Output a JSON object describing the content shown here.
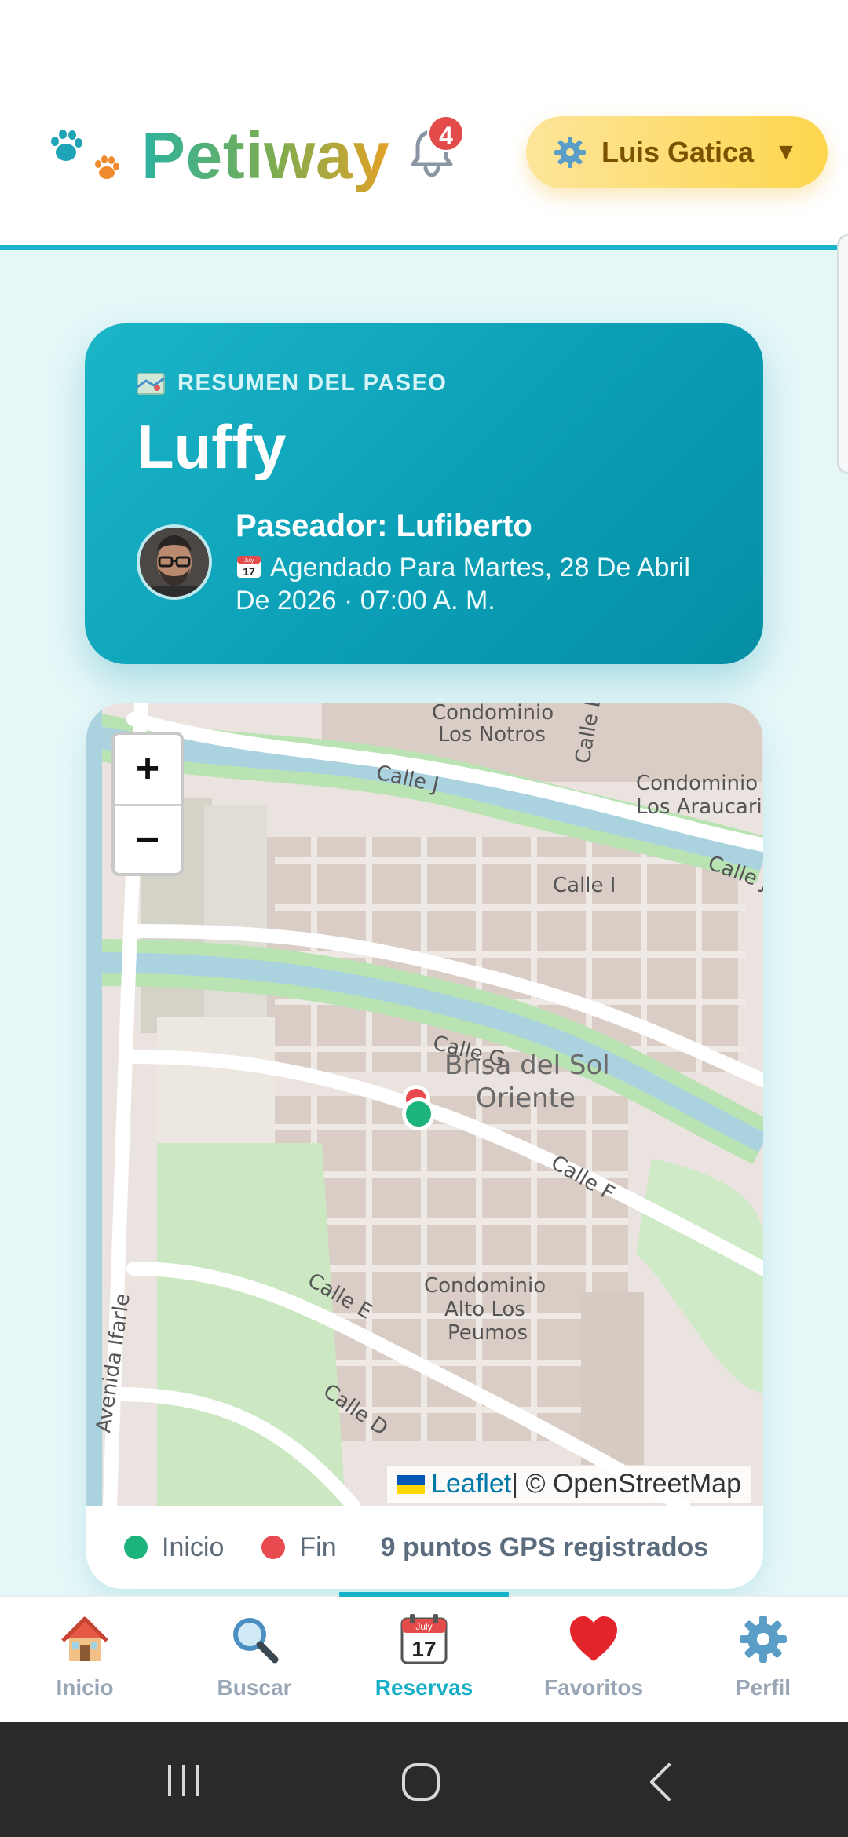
{
  "header": {
    "app_name": "Petiway",
    "notifications_count": "4",
    "user_name": "Luis Gatica",
    "user_caret": "▼"
  },
  "summary": {
    "label": "RESUMEN DEL PASEO",
    "pet_name": "Luffy",
    "walker": "Paseador: Lufiberto",
    "schedule": "Agendado Para Martes, 28 De Abril De 2026 · 07:00 A. M."
  },
  "map": {
    "zoom_in": "+",
    "zoom_out": "−",
    "labels": {
      "condominio_notros": [
        "Condominio",
        "Los Notros"
      ],
      "condominio_araucarias": [
        "Condominio",
        "Los Araucaria"
      ],
      "calle_l": "Calle L",
      "calle_j": "Calle J",
      "calle_j2": "Calle J",
      "calle_i": "Calle I",
      "calle_g": "Calle G",
      "calle_f": "Calle F",
      "calle_e": "Calle E",
      "calle_d": "Calle D",
      "avenida": "Avenida Ifarle",
      "brisa": [
        "Brisa del Sol",
        "Oriente"
      ],
      "condominio_alto": [
        "Condominio",
        "Alto Los",
        "Peumos"
      ]
    },
    "attribution_leaflet": "Leaflet",
    "attribution_rest": " | © OpenStreetMap"
  },
  "legend": {
    "start": "Inicio",
    "end": "Fin",
    "gps": "9 puntos GPS registrados",
    "start_color": "#1db37c",
    "end_color": "#e84a4f"
  },
  "nav": {
    "items": [
      {
        "label": "Inicio",
        "icon": "house-icon"
      },
      {
        "label": "Buscar",
        "icon": "magnifier-icon"
      },
      {
        "label": "Reservas",
        "icon": "calendar-icon",
        "calendar_month": "July",
        "calendar_day": "17"
      },
      {
        "label": "Favoritos",
        "icon": "heart-icon"
      },
      {
        "label": "Perfil",
        "icon": "gear-icon"
      }
    ],
    "active": "Reservas"
  },
  "summary_calendar": {
    "month": "July",
    "day": "17"
  },
  "colors": {
    "accent": "#19b3c9",
    "brand_gradient": [
      "#2db39f",
      "#e3a228"
    ]
  }
}
